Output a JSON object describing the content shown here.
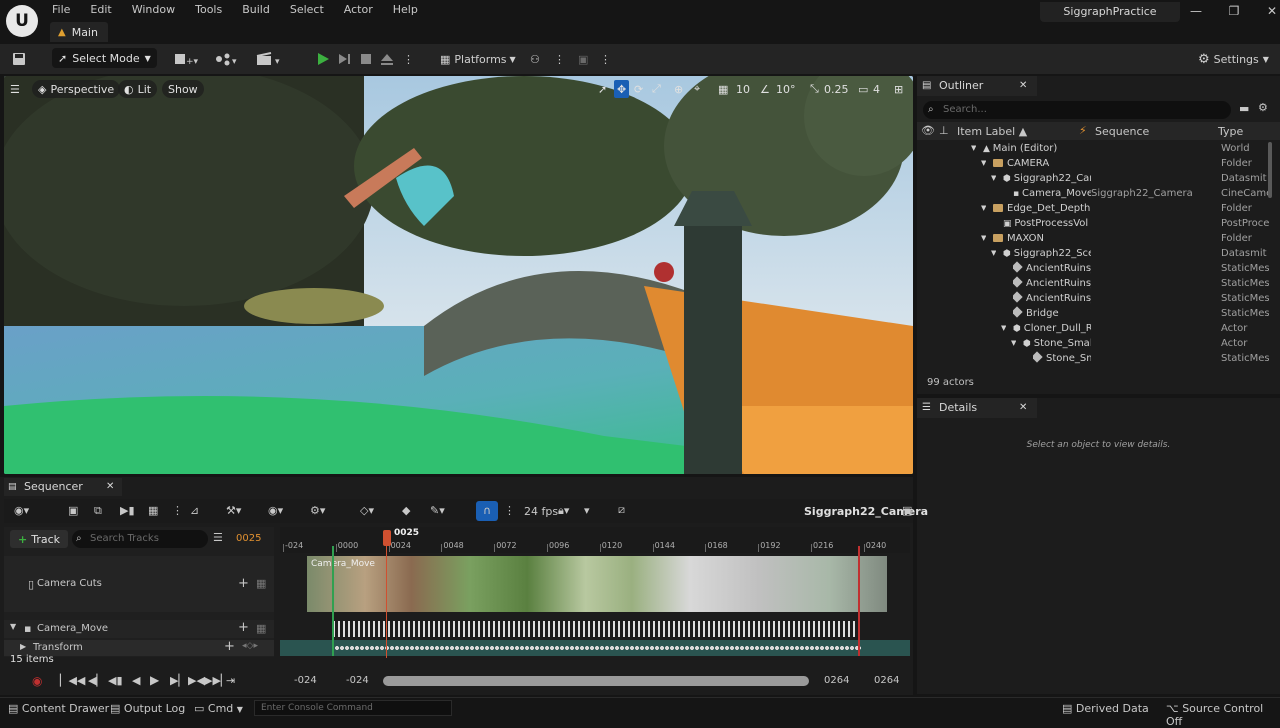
{
  "app": {
    "logo": "U",
    "document_tab": "Main",
    "project_name": "SiggraphPractice"
  },
  "menu": [
    "File",
    "Edit",
    "Window",
    "Tools",
    "Build",
    "Select",
    "Actor",
    "Help"
  ],
  "toolbar": {
    "select_mode": "Select Mode",
    "platforms": "Platforms",
    "settings": "Settings"
  },
  "viewport": {
    "perspective": "Perspective",
    "lit": "Lit",
    "show": "Show",
    "grid_size": "10",
    "rotation_snap": "10°",
    "scale_snap": "0.25",
    "camera_speed": "4"
  },
  "outliner": {
    "tab": "Outliner",
    "search_placeholder": "Search...",
    "columns": {
      "label": "Item Label ▲",
      "sequence": "Sequence",
      "type": "Type"
    },
    "rows": [
      {
        "label": "Main (Editor)",
        "sequence": "",
        "type": "World",
        "indent": 0,
        "icon": "world"
      },
      {
        "label": "CAMERA",
        "sequence": "",
        "type": "Folder",
        "indent": 1,
        "icon": "folder"
      },
      {
        "label": "Siggraph22_Car",
        "sequence": "",
        "type": "Datasmit",
        "indent": 2,
        "icon": "actor"
      },
      {
        "label": "Camera_Move",
        "sequence": "Siggraph22_Camera",
        "type": "CineCame",
        "indent": 3,
        "icon": "camera"
      },
      {
        "label": "Edge_Det_Depth",
        "sequence": "",
        "type": "Folder",
        "indent": 1,
        "icon": "folder"
      },
      {
        "label": "PostProcessVol",
        "sequence": "",
        "type": "PostProce",
        "indent": 2,
        "icon": "volume"
      },
      {
        "label": "MAXON",
        "sequence": "",
        "type": "Folder",
        "indent": 1,
        "icon": "folder"
      },
      {
        "label": "Siggraph22_Sce",
        "sequence": "",
        "type": "Datasmit",
        "indent": 2,
        "icon": "actor"
      },
      {
        "label": "AncientRuins_",
        "sequence": "",
        "type": "StaticMes",
        "indent": 3,
        "icon": "mesh"
      },
      {
        "label": "AncientRuins_",
        "sequence": "",
        "type": "StaticMes",
        "indent": 3,
        "icon": "mesh"
      },
      {
        "label": "AncientRuins_",
        "sequence": "",
        "type": "StaticMes",
        "indent": 3,
        "icon": "mesh"
      },
      {
        "label": "Bridge",
        "sequence": "",
        "type": "StaticMes",
        "indent": 3,
        "icon": "mesh"
      },
      {
        "label": "Cloner_Dull_R",
        "sequence": "",
        "type": "Actor",
        "indent": 3,
        "icon": "actor"
      },
      {
        "label": "Stone_Small",
        "sequence": "",
        "type": "Actor",
        "indent": 4,
        "icon": "actor"
      },
      {
        "label": "Stone_Sm",
        "sequence": "",
        "type": "StaticMes",
        "indent": 5,
        "icon": "mesh"
      }
    ],
    "actor_count": "99 actors"
  },
  "details": {
    "tab": "Details",
    "empty_message": "Select an object to view details."
  },
  "sequencer": {
    "tab": "Sequencer",
    "fps": "24 fps",
    "sequence_name": "Siggraph22_Camera",
    "track_button": "Track",
    "search_placeholder": "Search Tracks",
    "current_frame": "0025",
    "playhead_label": "0025",
    "ruler_ticks": [
      "-024",
      "0000",
      "0024",
      "0048",
      "0072",
      "0096",
      "0120",
      "0144",
      "0168",
      "0192",
      "0216",
      "0240"
    ],
    "tracks": [
      {
        "name": "Camera Cuts"
      },
      {
        "name": "Camera_Move"
      },
      {
        "name": "Transform"
      }
    ],
    "clip_label": "Camera_Move",
    "items_count": "15 items",
    "range_start_view": "-024",
    "range_start": "-024",
    "range_end": "0264",
    "range_end_view": "0264"
  },
  "statusbar": {
    "content_drawer": "Content Drawer",
    "output_log": "Output Log",
    "cmd": "Cmd",
    "console_placeholder": "Enter Console Command",
    "derived_data": "Derived Data",
    "source_control": "Source Control Off"
  }
}
